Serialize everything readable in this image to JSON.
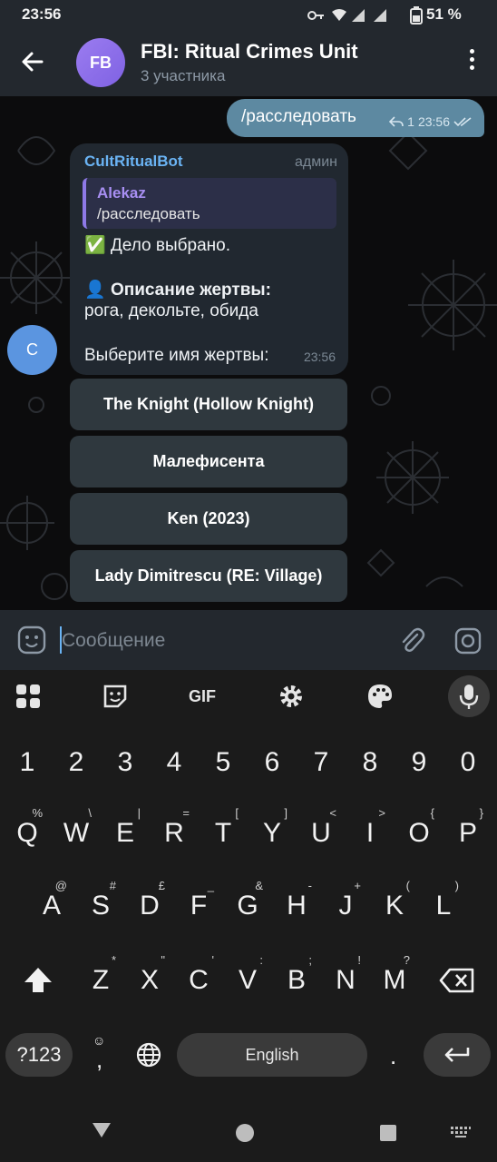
{
  "status_bar": {
    "time": "23:56",
    "battery": "51 %"
  },
  "header": {
    "avatar_initials": "FB",
    "title": "FBI: Ritual Crimes Unit",
    "subtitle": "3 участника"
  },
  "outgoing": {
    "text": "/расследовать",
    "replies": "1",
    "time": "23:56"
  },
  "incoming": {
    "avatar_initial": "C",
    "sender": "CultRitualBot",
    "role": "админ",
    "reply_name": "Alekaz",
    "reply_text": "/расследовать",
    "line1": "✅ Дело выбрано.",
    "line2_emoji": "👤",
    "line2_bold": "Описание жертвы:",
    "line3": "рога, декольте, обида",
    "line4": "Выберите имя жертвы:",
    "time": "23:56"
  },
  "inline_buttons": [
    "The Knight (Hollow Knight)",
    "Малефисента",
    "Ken (2023)",
    "Lady Dimitrescu (RE: Village)"
  ],
  "composer": {
    "placeholder": "Сообщение"
  },
  "keyboard": {
    "gif_label": "GIF",
    "number_row": [
      "1",
      "2",
      "3",
      "4",
      "5",
      "6",
      "7",
      "8",
      "9",
      "0"
    ],
    "row1": [
      {
        "k": "Q",
        "s": "%"
      },
      {
        "k": "W",
        "s": "\\"
      },
      {
        "k": "E",
        "s": "|"
      },
      {
        "k": "R",
        "s": "="
      },
      {
        "k": "T",
        "s": "["
      },
      {
        "k": "Y",
        "s": "]"
      },
      {
        "k": "U",
        "s": "<"
      },
      {
        "k": "I",
        "s": ">"
      },
      {
        "k": "O",
        "s": "{"
      },
      {
        "k": "P",
        "s": "}"
      }
    ],
    "row2": [
      {
        "k": "A",
        "s": "@"
      },
      {
        "k": "S",
        "s": "#"
      },
      {
        "k": "D",
        "s": "£"
      },
      {
        "k": "F",
        "s": "_"
      },
      {
        "k": "G",
        "s": "&"
      },
      {
        "k": "H",
        "s": "-"
      },
      {
        "k": "J",
        "s": "+"
      },
      {
        "k": "K",
        "s": "("
      },
      {
        "k": "L",
        "s": ")"
      }
    ],
    "row3": [
      {
        "k": "Z",
        "s": "*"
      },
      {
        "k": "X",
        "s": "\""
      },
      {
        "k": "C",
        "s": "'"
      },
      {
        "k": "V",
        "s": ":"
      },
      {
        "k": "B",
        "s": ";"
      },
      {
        "k": "N",
        "s": "!"
      },
      {
        "k": "M",
        "s": "?"
      }
    ],
    "symbols_label": "?123",
    "comma": ",",
    "space_label": "English",
    "period": "."
  }
}
